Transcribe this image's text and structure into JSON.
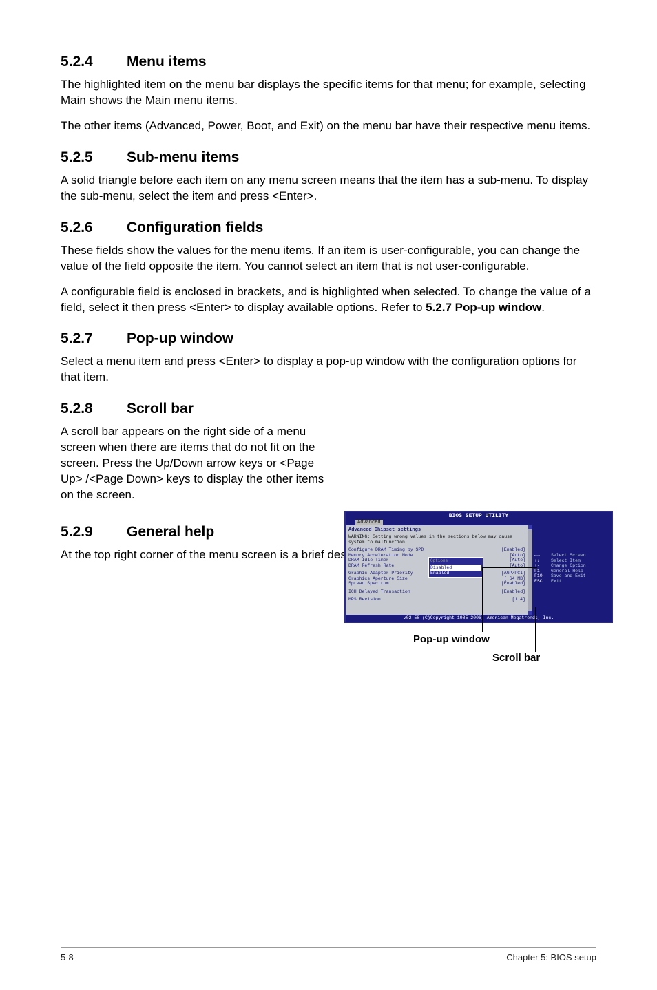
{
  "sections": {
    "s524": {
      "num": "5.2.4",
      "title": "Menu items",
      "p1": "The highlighted item on the menu bar displays the specific items for that menu; for example, selecting Main shows the Main menu items.",
      "p2": "The other items (Advanced, Power, Boot, and Exit) on the menu bar have their respective menu items."
    },
    "s525": {
      "num": "5.2.5",
      "title": "Sub-menu items",
      "p1": "A solid triangle before each item on any menu screen means that the item has a sub-menu. To display the sub-menu, select the item and press <Enter>."
    },
    "s526": {
      "num": "5.2.6",
      "title": "Configuration fields",
      "p1": "These fields show the values for the menu items. If an item is user-configurable, you can change the value of the field opposite the item. You cannot select an item that is not user-configurable.",
      "p2_a": "A configurable field is enclosed in brackets, and is highlighted when selected. To change the value of a field, select it then press <Enter> to display available options. Refer to ",
      "p2_b": "5.2.7 Pop-up window",
      "p2_c": "."
    },
    "s527": {
      "num": "5.2.7",
      "title": "Pop-up window",
      "p1": "Select a menu item and press <Enter> to display a pop-up window with the configuration options for that item."
    },
    "s528": {
      "num": "5.2.8",
      "title": "Scroll bar",
      "p1": "A scroll bar appears on the right side of a menu screen when there are items that do not fit on the screen. Press the Up/Down arrow keys or <Page Up> /<Page Down> keys to display the other items on the screen."
    },
    "s529": {
      "num": "5.2.9",
      "title": "General help",
      "p1": "At the top right corner of the menu screen is a brief description of the selected item."
    }
  },
  "figure": {
    "window_title": "BIOS SETUP UTILITY",
    "tab": "Advanced",
    "subtitle": "Advanced Chipset settings",
    "warning": "WARNING: Setting wrong values in the sections below may cause system to malfunction.",
    "rows": [
      {
        "label": "Configure DRAM Timing by SPD",
        "val": "[Enabled]"
      },
      {
        "label": "Memory Acceleration Mode",
        "val": "[Auto]"
      },
      {
        "label": "DRAM Idle Timer",
        "val": "[Auto]"
      },
      {
        "label": "DRAM Refresh Rate",
        "val": "[Auto]"
      },
      {
        "label": "Graphic Adapter Priority",
        "val": "[AGP/PCI]"
      },
      {
        "label": "Graphics Aperture Size",
        "val": "[ 64 MB]"
      },
      {
        "label": "Spread Spectrum",
        "val": "[Enabled]"
      },
      {
        "label": "ICH Delayed Transaction",
        "val": "[Enabled]"
      },
      {
        "label": "MPS Revision",
        "val": "[1.4]"
      }
    ],
    "popup_opts": [
      "Disabled",
      "Enabled"
    ],
    "help": [
      {
        "k": "←→",
        "t": "Select Screen"
      },
      {
        "k": "↑↓",
        "t": "Select Item"
      },
      {
        "k": "+-",
        "t": "Change Option"
      },
      {
        "k": "F1",
        "t": "General Help"
      },
      {
        "k": "F10",
        "t": "Save and Exit"
      },
      {
        "k": "ESC",
        "t": "Exit"
      }
    ],
    "copyright": "v02.58 (C)Copyright 1985-2006, American Megatrends, Inc.",
    "label_popup": "Pop-up window",
    "label_scroll": "Scroll bar"
  },
  "footer": {
    "left": "5-8",
    "right": "Chapter 5: BIOS setup"
  }
}
